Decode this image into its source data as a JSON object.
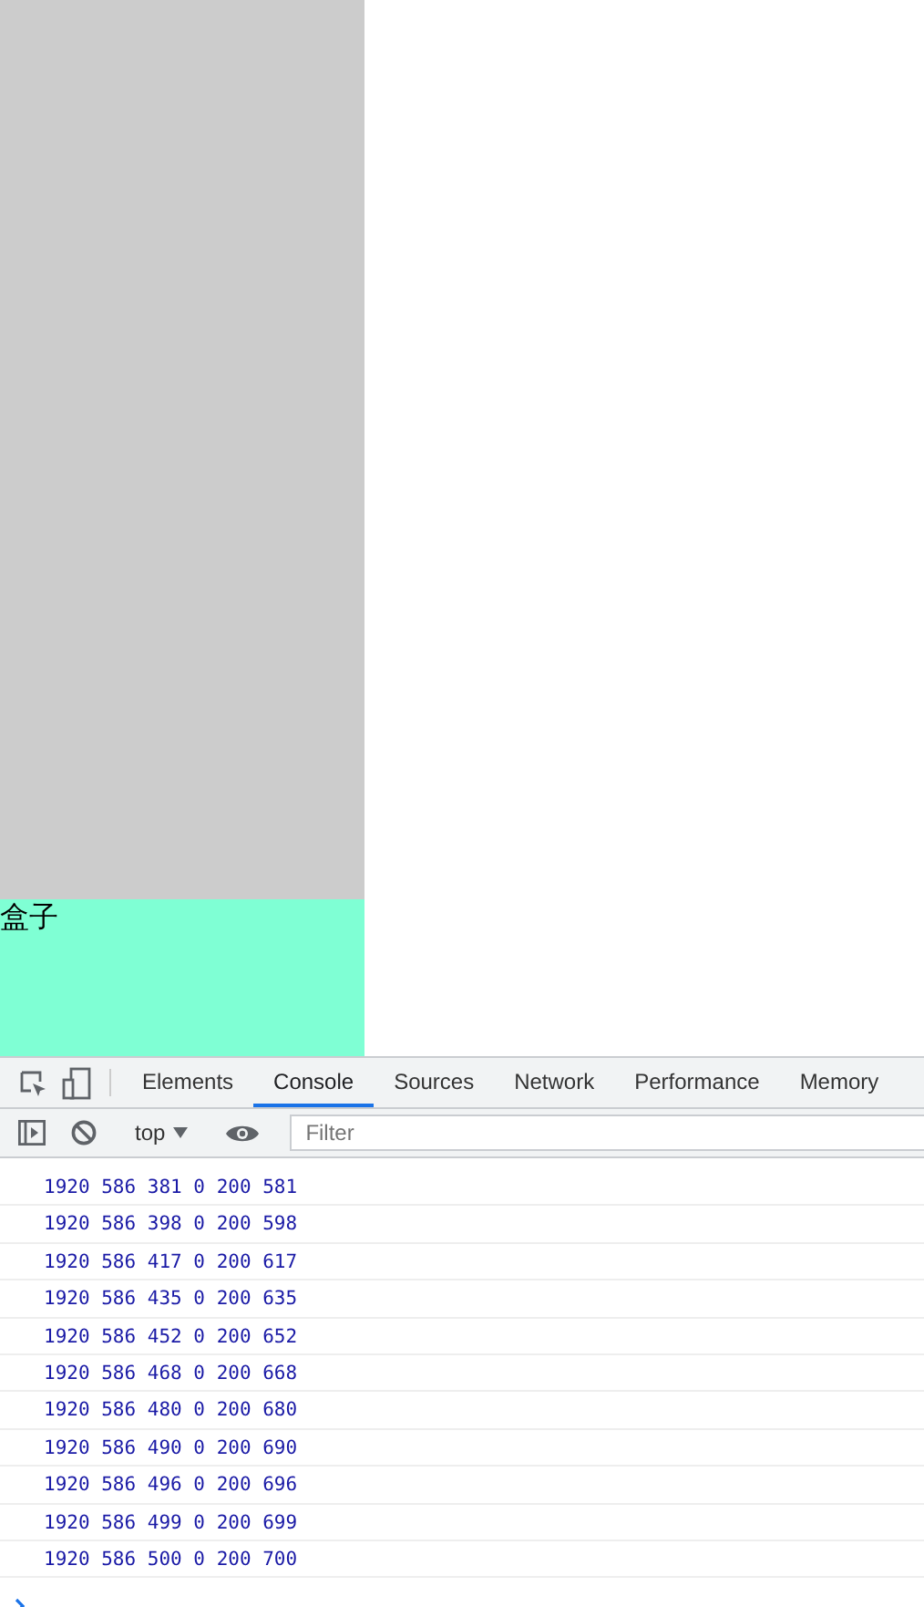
{
  "page": {
    "box_label": "盒子"
  },
  "devtools": {
    "tabs": [
      {
        "label": "Elements",
        "selected": false
      },
      {
        "label": "Console",
        "selected": true
      },
      {
        "label": "Sources",
        "selected": false
      },
      {
        "label": "Network",
        "selected": false
      },
      {
        "label": "Performance",
        "selected": false
      },
      {
        "label": "Memory",
        "selected": false
      }
    ],
    "context": "top",
    "filter": {
      "placeholder": "Filter"
    },
    "log": [
      "1920 586 381 0 200 581",
      "1920 586 398 0 200 598",
      "1920 586 417 0 200 617",
      "1920 586 435 0 200 635",
      "1920 586 452 0 200 652",
      "1920 586 468 0 200 668",
      "1920 586 480 0 200 680",
      "1920 586 490 0 200 690",
      "1920 586 496 0 200 696",
      "1920 586 499 0 200 699",
      "1920 586 500 0 200 700"
    ]
  }
}
